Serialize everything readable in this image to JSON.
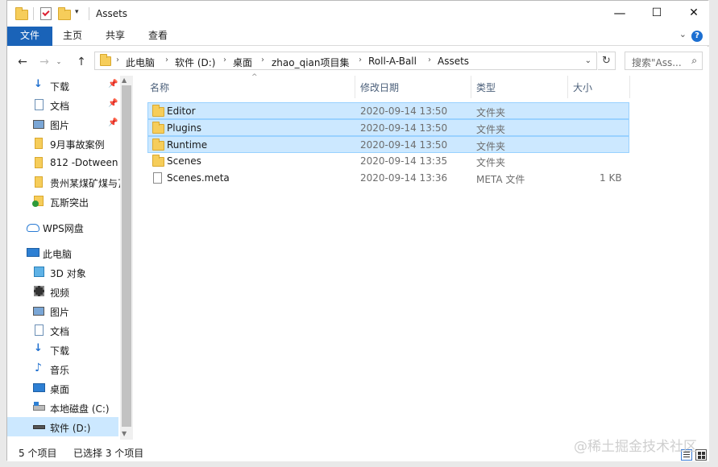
{
  "window": {
    "title": "Assets",
    "controls": {
      "minimize": "—",
      "maximize": "☐",
      "close": "✕"
    }
  },
  "ribbon": {
    "file_tab": "文件",
    "tabs": [
      "主页",
      "共享",
      "查看"
    ],
    "help": "?",
    "expand": "⌄"
  },
  "address": {
    "breadcrumbs": [
      "此电脑",
      "软件 (D:)",
      "桌面",
      "zhao_qian项目集",
      "Roll-A-Ball",
      "Assets"
    ],
    "search_placeholder": "搜索\"Ass...",
    "refresh": "↻"
  },
  "nav": {
    "quick_access": [
      {
        "label": "下载",
        "icon": "download-icon",
        "pinned": true
      },
      {
        "label": "文档",
        "icon": "document-icon",
        "pinned": true
      },
      {
        "label": "图片",
        "icon": "picture-icon",
        "pinned": true
      },
      {
        "label": "9月事故案例",
        "icon": "folder-icon",
        "pinned": false
      },
      {
        "label": "812 -Dotween",
        "icon": "folder-icon",
        "pinned": false
      },
      {
        "label": "贵州某煤矿煤与瓦",
        "icon": "folder-icon",
        "pinned": false
      },
      {
        "label": "瓦斯突出",
        "icon": "folder-check-icon",
        "pinned": false
      }
    ],
    "wps": "WPS网盘",
    "this_pc": "此电脑",
    "pc_items": [
      {
        "label": "3D 对象",
        "icon": "cube-icon"
      },
      {
        "label": "视频",
        "icon": "video-icon"
      },
      {
        "label": "图片",
        "icon": "picture-icon"
      },
      {
        "label": "文档",
        "icon": "document-icon"
      },
      {
        "label": "下载",
        "icon": "download-icon"
      },
      {
        "label": "音乐",
        "icon": "music-icon"
      },
      {
        "label": "桌面",
        "icon": "desktop-icon"
      },
      {
        "label": "本地磁盘 (C:)",
        "icon": "drive-c-icon"
      },
      {
        "label": "软件 (D:)",
        "icon": "drive-d-icon"
      }
    ]
  },
  "columns": {
    "name": "名称",
    "date": "修改日期",
    "type": "类型",
    "size": "大小"
  },
  "files": [
    {
      "name": "Editor",
      "date": "2020-09-14 13:50",
      "type": "文件夹",
      "size": "",
      "icon": "folder-icon",
      "selected": true
    },
    {
      "name": "Plugins",
      "date": "2020-09-14 13:50",
      "type": "文件夹",
      "size": "",
      "icon": "folder-icon",
      "selected": true
    },
    {
      "name": "Runtime",
      "date": "2020-09-14 13:50",
      "type": "文件夹",
      "size": "",
      "icon": "folder-icon",
      "selected": true
    },
    {
      "name": "Scenes",
      "date": "2020-09-14 13:35",
      "type": "文件夹",
      "size": "",
      "icon": "folder-icon",
      "selected": false
    },
    {
      "name": "Scenes.meta",
      "date": "2020-09-14 13:36",
      "type": "META 文件",
      "size": "1 KB",
      "icon": "file-icon",
      "selected": false
    }
  ],
  "status": {
    "count": "5 个项目",
    "selected": "已选择 3 个项目"
  },
  "watermark": "@稀土掘金技术社区"
}
